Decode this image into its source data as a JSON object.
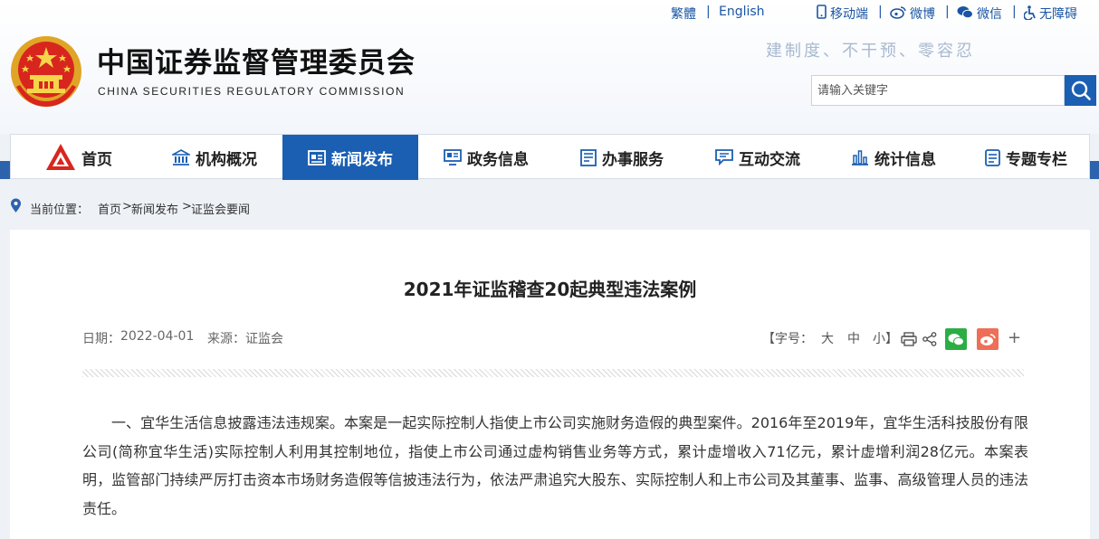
{
  "toplinks": {
    "traditional": "繁體",
    "english": "English",
    "mobile": "移动端",
    "weibo": "微博",
    "wechat": "微信",
    "accessibility": "无障碍"
  },
  "site": {
    "title": "中国证券监督管理委员会",
    "subtitle": "CHINA SECURITIES REGULATORY COMMISSION",
    "slogan": "建制度、不干预、零容忍"
  },
  "search": {
    "placeholder": "请输入关键字"
  },
  "nav": {
    "items": [
      {
        "label": "首页",
        "icon": "csrc-logo-icon"
      },
      {
        "label": "机构概况",
        "icon": "building-icon"
      },
      {
        "label": "新闻发布",
        "icon": "news-icon",
        "active": true
      },
      {
        "label": "政务信息",
        "icon": "monitor-icon"
      },
      {
        "label": "办事服务",
        "icon": "form-icon"
      },
      {
        "label": "互动交流",
        "icon": "chat-icon"
      },
      {
        "label": "统计信息",
        "icon": "chart-icon"
      },
      {
        "label": "专题专栏",
        "icon": "document-icon"
      }
    ]
  },
  "breadcrumb": {
    "prefix": "当前位置：",
    "home": "首页",
    "sep1": ">",
    "section": "新闻发布",
    "sep2": ">",
    "current": "证监会要闻"
  },
  "article": {
    "title": "2021年证监稽查20起典型违法案例",
    "date_label": "日期：",
    "date": "2022-04-01",
    "source_label": "来源：",
    "source": "证监会",
    "fontsize_label": "【字号：",
    "size_large": "大",
    "size_medium": "中",
    "size_small": "小",
    "fontsize_close": "】",
    "more": "+",
    "paragraph": "一、宜华生活信息披露违法违规案。本案是一起实际控制人指使上市公司实施财务造假的典型案件。2016年至2019年，宜华生活科技股份有限公司(简称宜华生活)实际控制人利用其控制地位，指使上市公司通过虚构销售业务等方式，累计虚增收入71亿元，累计虚增利润28亿元。本案表明，监管部门持续严厉打击资本市场财务造假等信披违法行为，依法严肃追究大股东、实际控制人和上市公司及其董事、监事、高级管理人员的违法责任。"
  },
  "colors": {
    "brand_blue": "#1b5fb3",
    "nav_band": "#2d63ad",
    "wechat_green": "#2aae43",
    "weibo_red": "#ef6e57"
  }
}
